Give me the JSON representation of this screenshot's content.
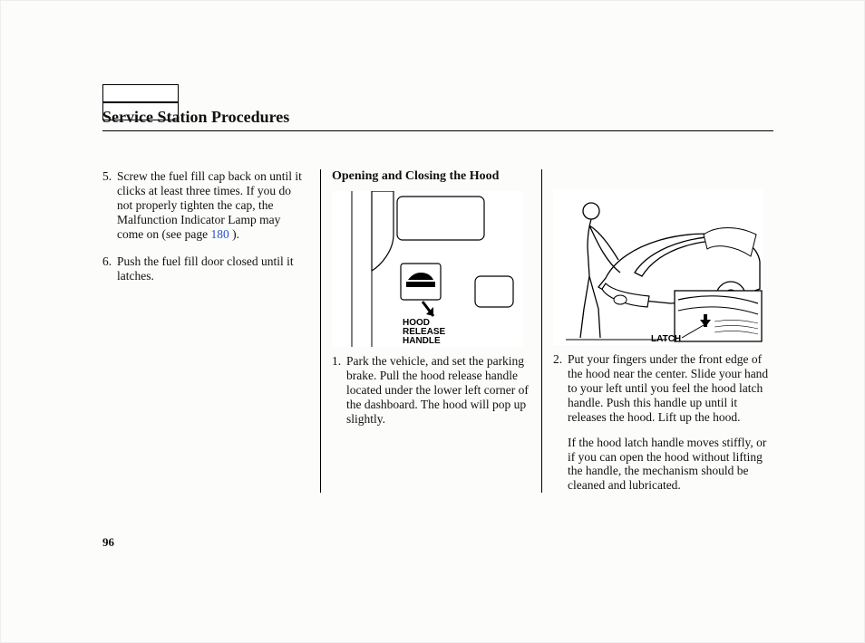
{
  "title": "Service Station Procedures",
  "page_number": "96",
  "col1": {
    "step5_num": "5.",
    "step5_text_pre": "Screw the fuel fill cap back on until it clicks at least three times. If you do not properly tighten the cap, the Malfunction Indicator Lamp may come on (see page ",
    "step5_link": "180",
    "step5_text_post": " ).",
    "step6_num": "6.",
    "step6_text": "Push the fuel fill door closed until it latches."
  },
  "col2": {
    "subheading": "Opening and Closing the Hood",
    "ill_label_l1": "HOOD",
    "ill_label_l2": "RELEASE",
    "ill_label_l3": "HANDLE",
    "step1_num": "1.",
    "step1_text": "Park the vehicle, and set the parking brake. Pull the hood release handle located under the lower left corner of the dashboard. The hood will pop up slightly."
  },
  "col3": {
    "ill_label": "LATCH",
    "step2_num": "2.",
    "step2_text": "Put your fingers under the front edge of the hood near the center. Slide your hand to your left until you feel the hood latch handle. Push this handle up until it releases the hood. Lift up the hood.",
    "para2": "If the hood latch handle moves stiffly, or if you can open the hood without lifting the handle, the mechanism should be cleaned and lubricated."
  }
}
